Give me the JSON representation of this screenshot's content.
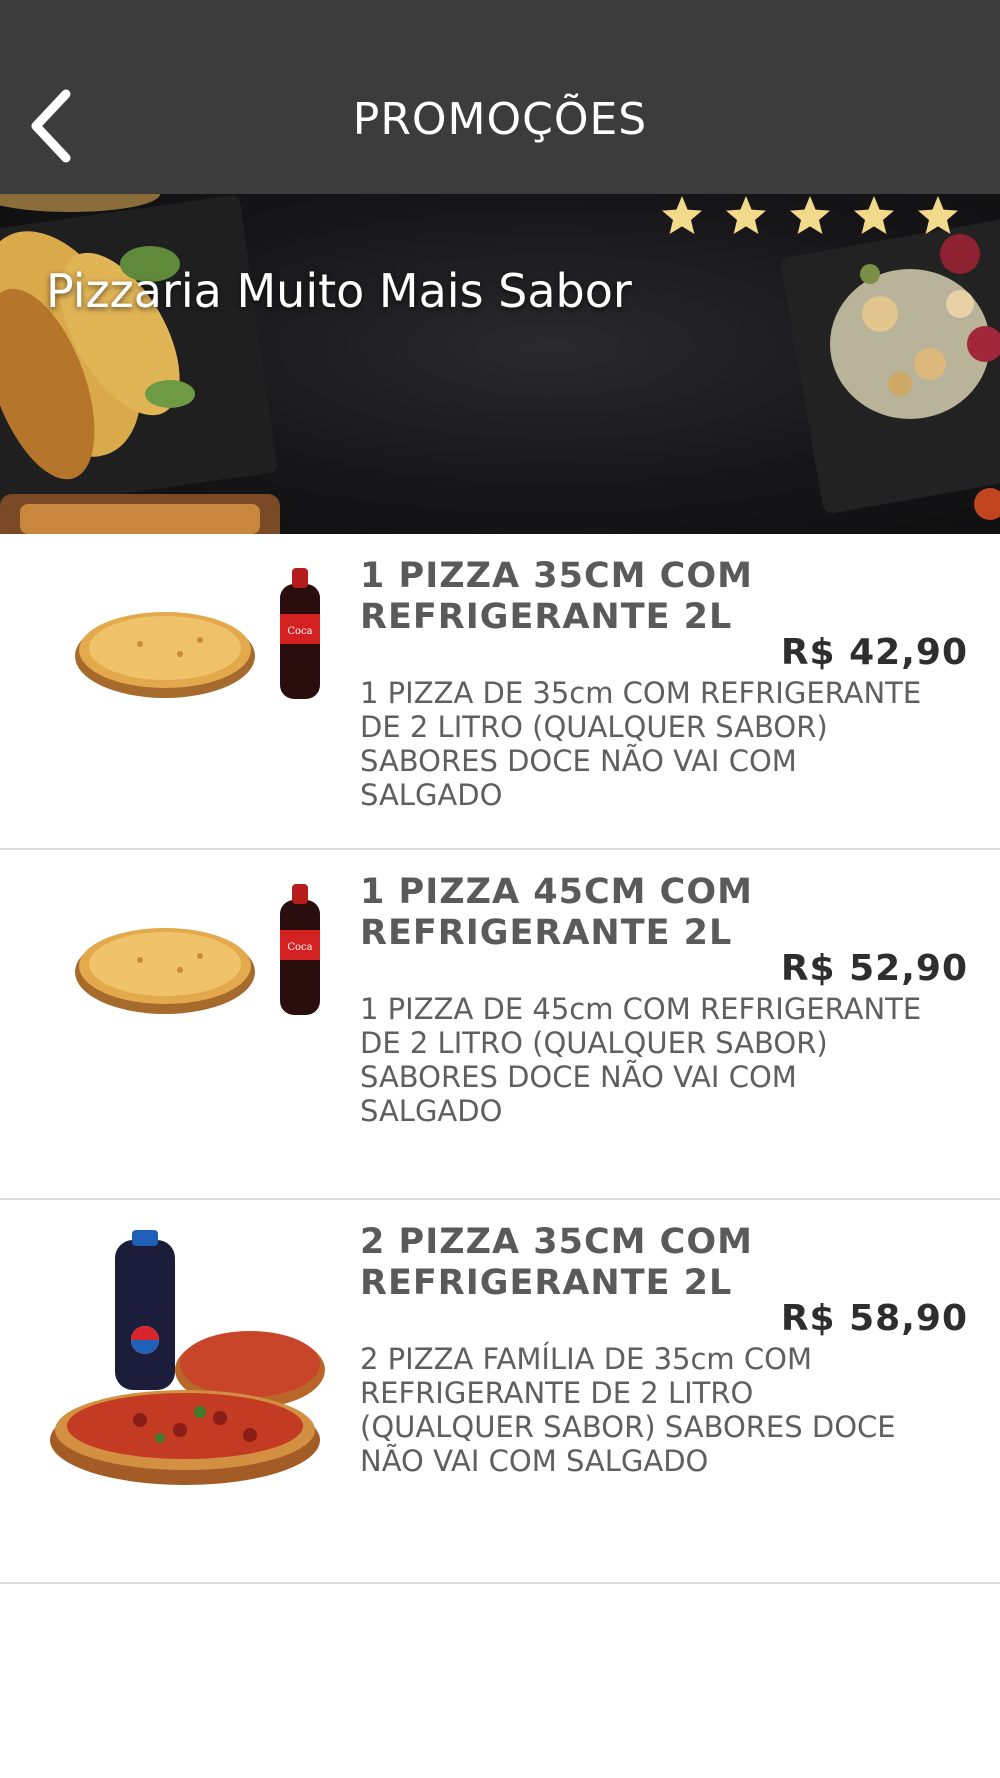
{
  "header": {
    "title": "PROMOÇÕES",
    "back_icon": "chevron-left-icon"
  },
  "restaurant": {
    "name": "Pizzaria Muito Mais Sabor",
    "rating_stars": 5,
    "star_color": "#f2d98c"
  },
  "promotions": [
    {
      "title_line1": "1 PIZZA 35CM COM",
      "title_line2": "REFRIGERANTE 2L",
      "price": "R$ 42,90",
      "desc_lines": [
        "1 PIZZA DE 35cm COM REFRIGERANTE",
        "DE 2 LITRO (QUALQUER SABOR)",
        "SABORES DOCE NÃO VAI COM",
        "SALGADO"
      ]
    },
    {
      "title_line1": "1 PIZZA 45CM COM",
      "title_line2": "REFRIGERANTE 2L",
      "price": "R$ 52,90",
      "desc_lines": [
        "1 PIZZA DE 45cm COM REFRIGERANTE",
        "DE 2 LITRO (QUALQUER SABOR)",
        "SABORES DOCE NÃO VAI COM",
        "SALGADO"
      ]
    },
    {
      "title_line1": "2 PIZZA 35CM COM",
      "title_line2": "REFRIGERANTE 2L",
      "price": "R$ 58,90",
      "desc_lines": [
        "2 PIZZA FAMÍLIA DE 35cm COM",
        "REFRIGERANTE DE 2 LITRO",
        "(QUALQUER SABOR) SABORES DOCE",
        "NÃO VAI COM SALGADO"
      ]
    }
  ]
}
